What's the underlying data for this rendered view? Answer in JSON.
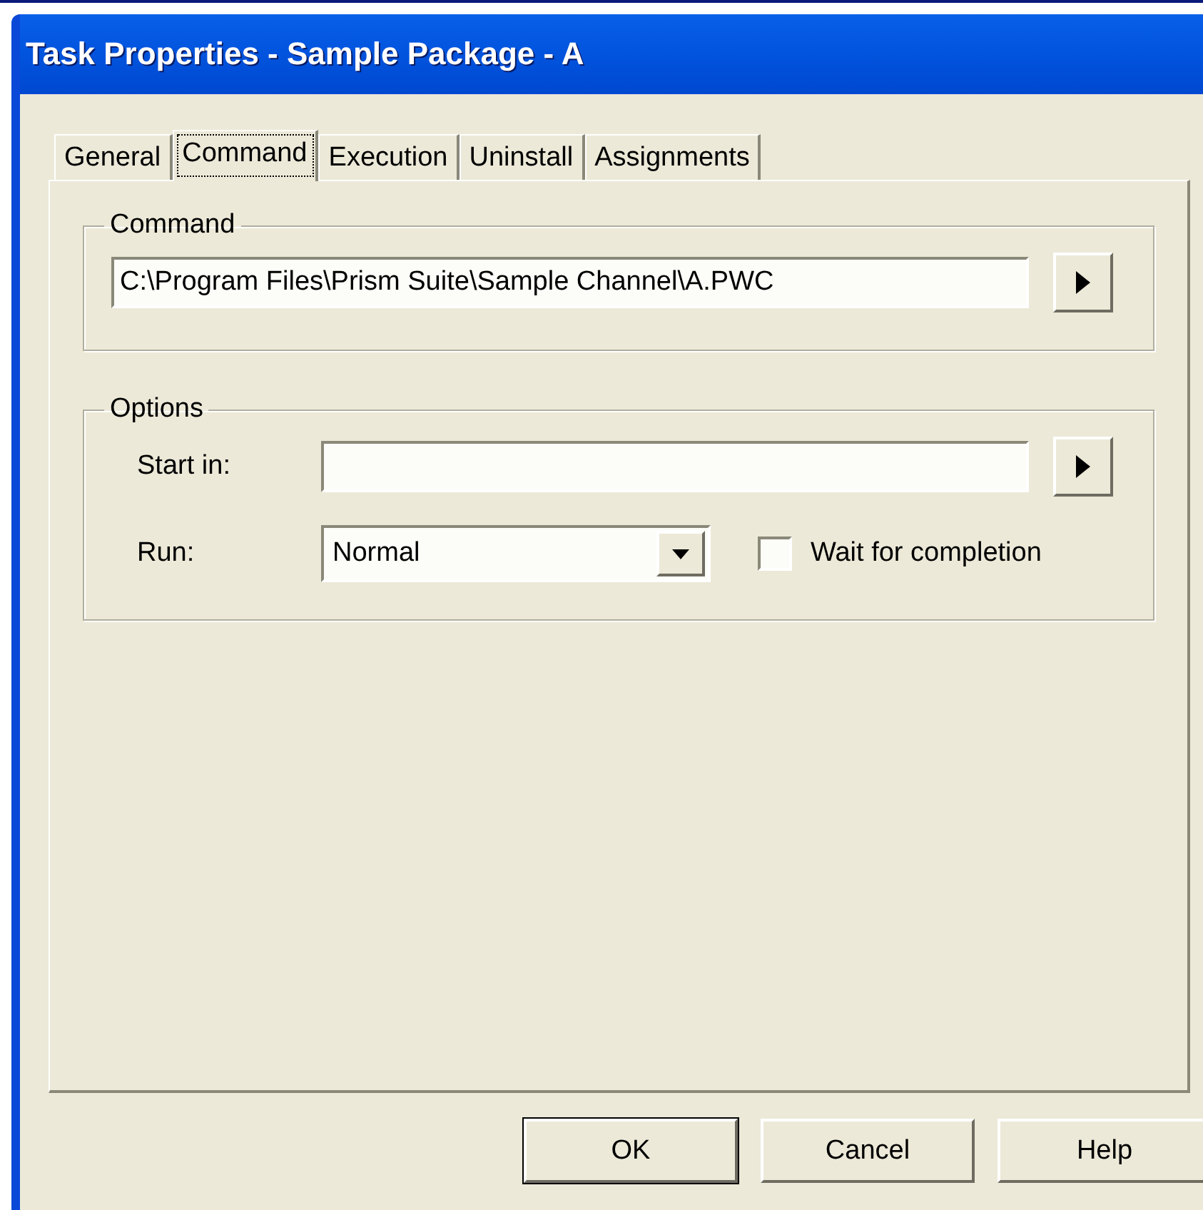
{
  "window": {
    "title": "Task Properties - Sample Package - A"
  },
  "tabs": [
    {
      "label": "General",
      "selected": false
    },
    {
      "label": "Command",
      "selected": true
    },
    {
      "label": "Execution",
      "selected": false
    },
    {
      "label": "Uninstall",
      "selected": false
    },
    {
      "label": "Assignments",
      "selected": false
    }
  ],
  "command_group": {
    "title": "Command",
    "path": "C:\\Program Files\\Prism Suite\\Sample Channel\\A.PWC"
  },
  "options_group": {
    "title": "Options",
    "start_in_label": "Start in:",
    "run_label": "Run:",
    "run_value": "Normal",
    "wait": {
      "label": "Wait for completion",
      "checked": false
    }
  },
  "buttons": [
    {
      "label": "OK",
      "default": true
    },
    {
      "label": "Cancel",
      "default": false
    },
    {
      "label": "Help",
      "default": false
    }
  ]
}
